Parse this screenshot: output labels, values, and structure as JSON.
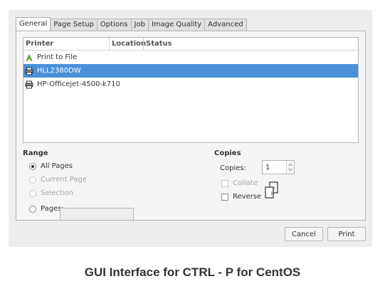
{
  "tabs": [
    "General",
    "Page Setup",
    "Options",
    "Job",
    "Image Quality",
    "Advanced"
  ],
  "printer_list": {
    "columns": [
      "Printer",
      "Location",
      "Status"
    ],
    "rows": [
      {
        "name": "Print to File",
        "icon": "file-printer-icon"
      },
      {
        "name": "HLL2380DW",
        "icon": "printer-icon"
      },
      {
        "name": "HP-Officejet-4500-k710",
        "icon": "printer-icon"
      }
    ],
    "selected": "HLL2380DW"
  },
  "range": {
    "title": "Range",
    "all_pages": "All Pages",
    "current_page": "Current Page",
    "selection": "Selection",
    "pages": "Pages:",
    "pages_value": ""
  },
  "copies": {
    "title": "Copies",
    "copies_label": "Copies:",
    "copies_value": "1",
    "collate": "Collate",
    "reverse": "Reverse"
  },
  "buttons": {
    "cancel": "Cancel",
    "print": "Print"
  },
  "caption": "GUI Interface for CTRL - P for CentOS",
  "colors": {
    "selection": "#4a90d9",
    "dialog_bg": "#ededed"
  }
}
